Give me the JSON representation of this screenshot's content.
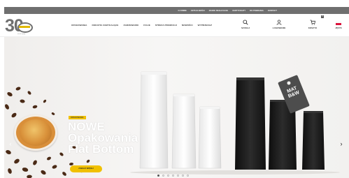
{
  "topbar": {
    "links": [
      "O FIRMIE",
      "AKTUALNOŚCI",
      "NASZE REALIZACJE",
      "CERTYFIKATY",
      "DO POBRANIA",
      "KONTAKT"
    ]
  },
  "logo": {
    "number": "30",
    "tagline": "wcisk czysty"
  },
  "nav": {
    "items": [
      "OPAKOWANIA",
      "DODATKI ZAMYKAJĄCE",
      "ZGRZEWARKI",
      "FOLIE",
      "STREFA PROMOCJI",
      "NOWOŚCI",
      "WYPRZEDAŻ"
    ]
  },
  "utils": {
    "search_label": "SZUKAJ",
    "login_label": "LOGOWANIE",
    "cart_label": "KOSZYK",
    "cart_count": "0",
    "lang_label": "JĘZYK",
    "lang_flag_colors": [
      "#ffffff",
      "#dc143c"
    ]
  },
  "hero": {
    "eyebrow": "OPAKOWANIA",
    "title_lines": [
      "NOWE",
      "Opakowania",
      "Flat Bottom"
    ],
    "cta": "ZOBACZ WIĘCEJ",
    "tag_text": "MAT B&W",
    "prev_arrow": "‹",
    "next_arrow": "›",
    "slides_total": 7,
    "active_slide": 0
  },
  "colors": {
    "topbar": "#6f6f6f",
    "accent": "#f0c000",
    "bag_white": "#fafafa",
    "bag_black": "#1c1c1c"
  }
}
